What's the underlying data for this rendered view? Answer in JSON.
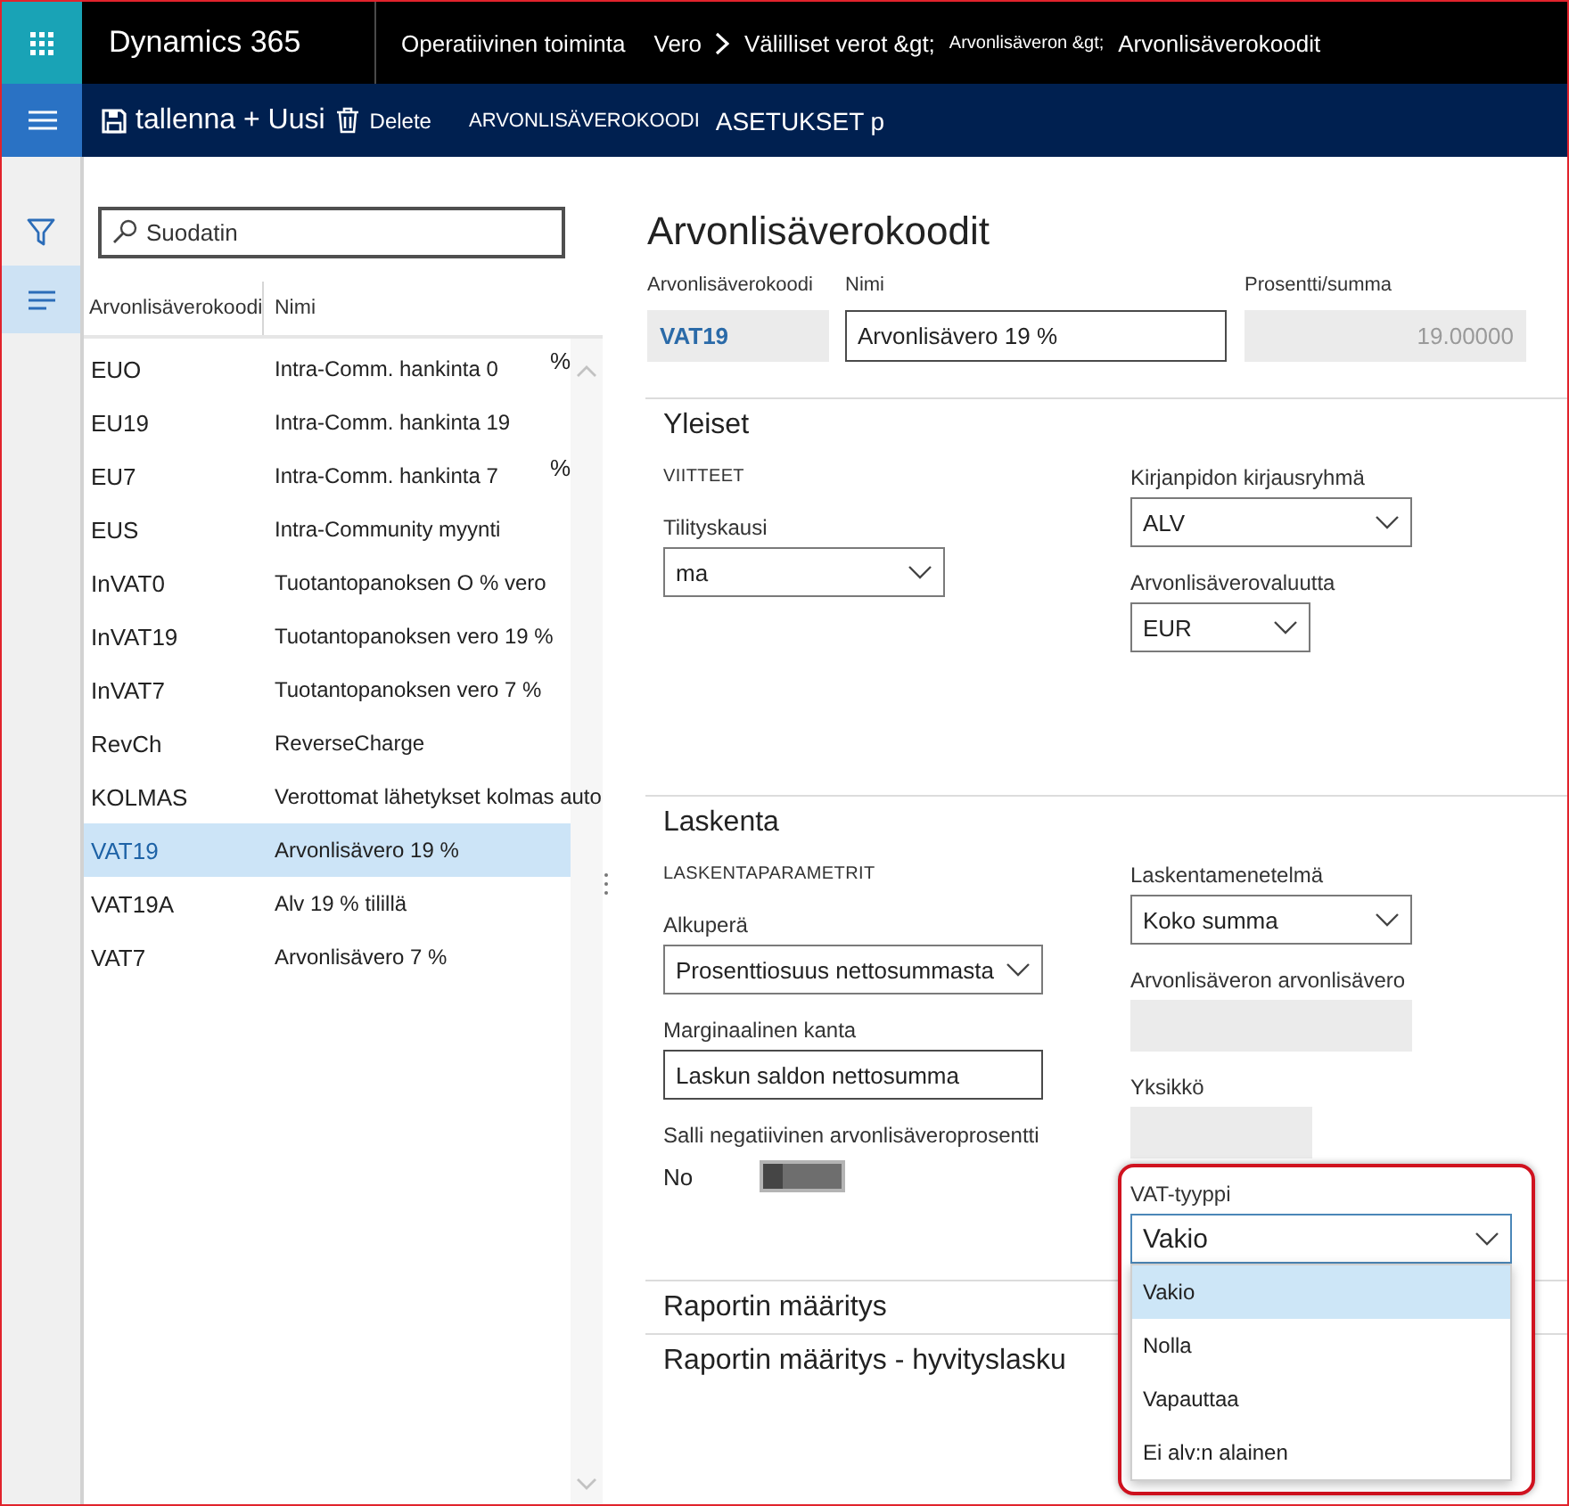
{
  "top_bar": {
    "app_name": "Dynamics 365",
    "breadcrumbs": [
      {
        "kind": "module",
        "text": "Operatiivinen toiminta"
      },
      {
        "kind": "crumb",
        "text": "Vero"
      },
      {
        "kind": "chevron"
      },
      {
        "kind": "crumb",
        "text": "Välilliset verot &gt;"
      },
      {
        "kind": "minor",
        "text": "Arvonlisäveron &gt;"
      },
      {
        "kind": "crumb",
        "text": "Arvonlisäverokoodit"
      }
    ]
  },
  "action_bar": {
    "items": [
      {
        "kind": "save",
        "label": "tallenna + Uusi"
      },
      {
        "kind": "delete",
        "label": "Delete"
      },
      {
        "kind": "caption",
        "label": "ARVONLISÄVEROKOODI"
      },
      {
        "kind": "tab",
        "label": "ASETUKSET p"
      }
    ]
  },
  "nav_rail": {
    "items": [
      {
        "kind": "filter",
        "selected": false
      },
      {
        "kind": "list",
        "selected": true
      }
    ]
  },
  "list_panel": {
    "filter": {
      "placeholder": "Suodatin"
    },
    "columns": [
      "Arvonlisäverokoodi",
      "Nimi"
    ],
    "rows": [
      {
        "code": "EUO",
        "name": "Intra-Comm. hankinta 0",
        "suffix": "%",
        "selected": false
      },
      {
        "code": "EU19",
        "name": "Intra-Comm. hankinta 19",
        "selected": false
      },
      {
        "code": "EU7",
        "name": "Intra-Comm. hankinta 7",
        "suffix": "%",
        "selected": false
      },
      {
        "code": "EUS",
        "name": "Intra-Community myynti",
        "selected": false
      },
      {
        "code": "InVAT0",
        "name": "Tuotantopanoksen O % vero",
        "selected": false
      },
      {
        "code": "InVAT19",
        "name": "Tuotantopanoksen vero 19 %",
        "selected": false
      },
      {
        "code": "InVAT7",
        "name": "Tuotantopanoksen vero 7 %",
        "selected": false
      },
      {
        "code": "RevCh",
        "name": "ReverseCharge",
        "selected": false
      },
      {
        "code": "KOLMAS",
        "name": "Verottomat lähetykset kolmas auto",
        "selected": false
      },
      {
        "code": "VAT19",
        "name": "Arvonlisävero 19 %",
        "selected": true
      },
      {
        "code": "VAT19A",
        "name": "Alv 19 % tilillä",
        "selected": false
      },
      {
        "code": "VAT7",
        "name": "Arvonlisävero 7 %",
        "selected": false
      }
    ]
  },
  "form": {
    "title": "Arvonlisäverokoodit",
    "header_fields": [
      {
        "kind": "code",
        "label": "Arvonlisäverokoodi",
        "value": "VAT19",
        "disabled": false
      },
      {
        "kind": "input",
        "label": "Nimi",
        "value": "Arvonlisävero 19 %",
        "disabled": false
      },
      {
        "kind": "number",
        "label": "Prosentti/summa",
        "value": "19.00000",
        "disabled": true
      }
    ],
    "sections": [
      {
        "title": "Yleiset",
        "left_fields": [
          {
            "kind": "group",
            "text": "VIITTEET"
          },
          {
            "kind": "select",
            "label": "Tilityskausi",
            "value": "ma",
            "expanded": false
          }
        ],
        "right_fields": [
          {
            "kind": "select",
            "label": "Kirjanpidon kirjausryhmä",
            "value": "ALV",
            "expanded": false
          },
          {
            "kind": "select",
            "label": "Arvonlisäverovaluutta",
            "value": "EUR",
            "expanded": false
          }
        ]
      },
      {
        "title": "Laskenta",
        "left_fields": [
          {
            "kind": "group",
            "text": "LASKENTAPARAMETRIT"
          },
          {
            "kind": "select",
            "label": "Alkuperä",
            "value": "Prosenttiosuus nettosummasta",
            "expanded": false
          },
          {
            "kind": "input",
            "label": "Marginaalinen kanta",
            "value": "Laskun saldon nettosumma"
          },
          {
            "kind": "toggle",
            "label": "Salli negatiivinen arvonlisäveroprosentti",
            "state_text": "No",
            "on": false
          }
        ],
        "right_fields": [
          {
            "kind": "select",
            "label": "Laskentamenetelmä",
            "value": "Koko summa",
            "expanded": false
          },
          {
            "kind": "readonly",
            "label": "Arvonlisäveron arvonlisävero"
          },
          {
            "kind": "readonly",
            "label": "Yksikkö"
          },
          {
            "kind": "select",
            "label": "VAT-tyyppi",
            "value": "Vakio",
            "expanded": true,
            "highlighted": true,
            "options": [
              {
                "label": "Vakio",
                "selected": true
              },
              {
                "label": "Nolla",
                "selected": false
              },
              {
                "label": "Vapauttaa",
                "selected": false
              },
              {
                "label": "Ei alv:n alainen",
                "selected": false
              }
            ]
          }
        ]
      },
      {
        "title": "Raportin määritys"
      },
      {
        "title": "Raportin määritys - hyvityslasku"
      }
    ]
  }
}
